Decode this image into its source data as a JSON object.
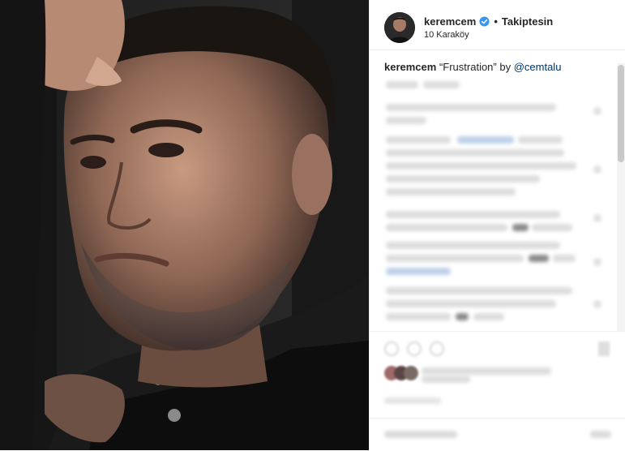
{
  "header": {
    "username": "keremcem",
    "separator": "•",
    "follow_label": "Takiptesin",
    "location": "10 Karaköy"
  },
  "caption": {
    "username": "keremcem",
    "text": "“Frustration” by ",
    "mention": "@cemtalu"
  },
  "icons": {
    "verified": "verified-badge-icon",
    "like": "heart-icon",
    "comment": "comment-icon",
    "share": "share-icon",
    "save": "bookmark-icon"
  },
  "colors": {
    "verified": "#3897f0",
    "mention": "#003569",
    "text": "#262626"
  }
}
